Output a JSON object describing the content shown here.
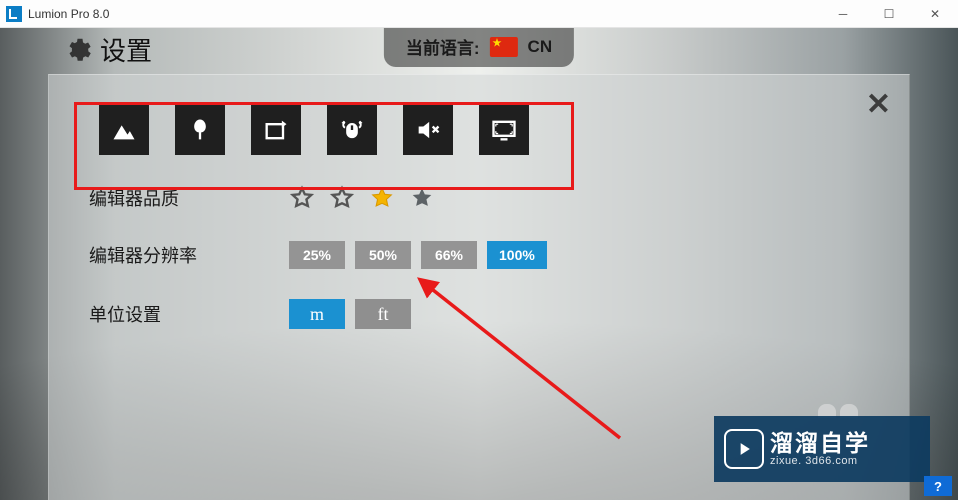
{
  "window": {
    "title": "Lumion Pro 8.0"
  },
  "page_title": "设置",
  "language": {
    "label": "当前语言:",
    "code": "CN"
  },
  "settings": {
    "quality_label": "编辑器品质",
    "resolution_label": "编辑器分辨率",
    "units_label": "单位设置",
    "resolution_options": [
      "25%",
      "50%",
      "66%",
      "100%"
    ],
    "resolution_active": "100%",
    "unit_options": [
      "m",
      "ft"
    ],
    "unit_active": "m",
    "quality_stars_selected": 3
  },
  "brand": {
    "main": "溜溜自学",
    "sub": "zixue. 3d66.com"
  },
  "help_label": "?"
}
